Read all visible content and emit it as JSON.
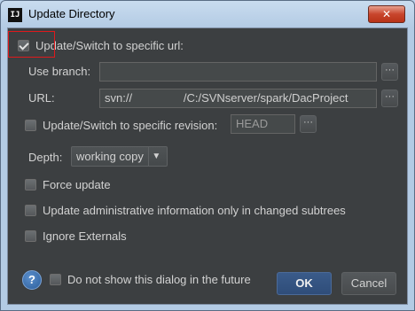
{
  "window": {
    "title": "Update Directory",
    "close_glyph": "✕"
  },
  "options": {
    "switch_url_label": "Update/Switch to specific url:",
    "switch_url_checked": true,
    "use_branch_label": "Use branch:",
    "use_branch_value": "",
    "url_label": "URL:",
    "url_value": "svn://                /C:/SVNserver/spark/DacProject",
    "browse_glyph": "···",
    "switch_revision_label": "Update/Switch to specific revision:",
    "switch_revision_checked": false,
    "revision_value": "HEAD",
    "depth_label": "Depth:",
    "depth_value": "working copy",
    "force_update_label": "Force update",
    "update_admin_label": "Update administrative information only in changed subtrees",
    "ignore_externals_label": "Ignore Externals"
  },
  "footer": {
    "help_glyph": "?",
    "do_not_show_label": "Do not show this dialog in the future",
    "ok_label": "OK",
    "cancel_label": "Cancel"
  },
  "colors": {
    "panel": "#3c3f41",
    "highlight": "#e0191c",
    "ok_button": "#2f4d79"
  },
  "icons": [
    "intellij-app-icon",
    "close-icon",
    "help-icon",
    "dropdown-arrow-icon",
    "browse-icon"
  ]
}
